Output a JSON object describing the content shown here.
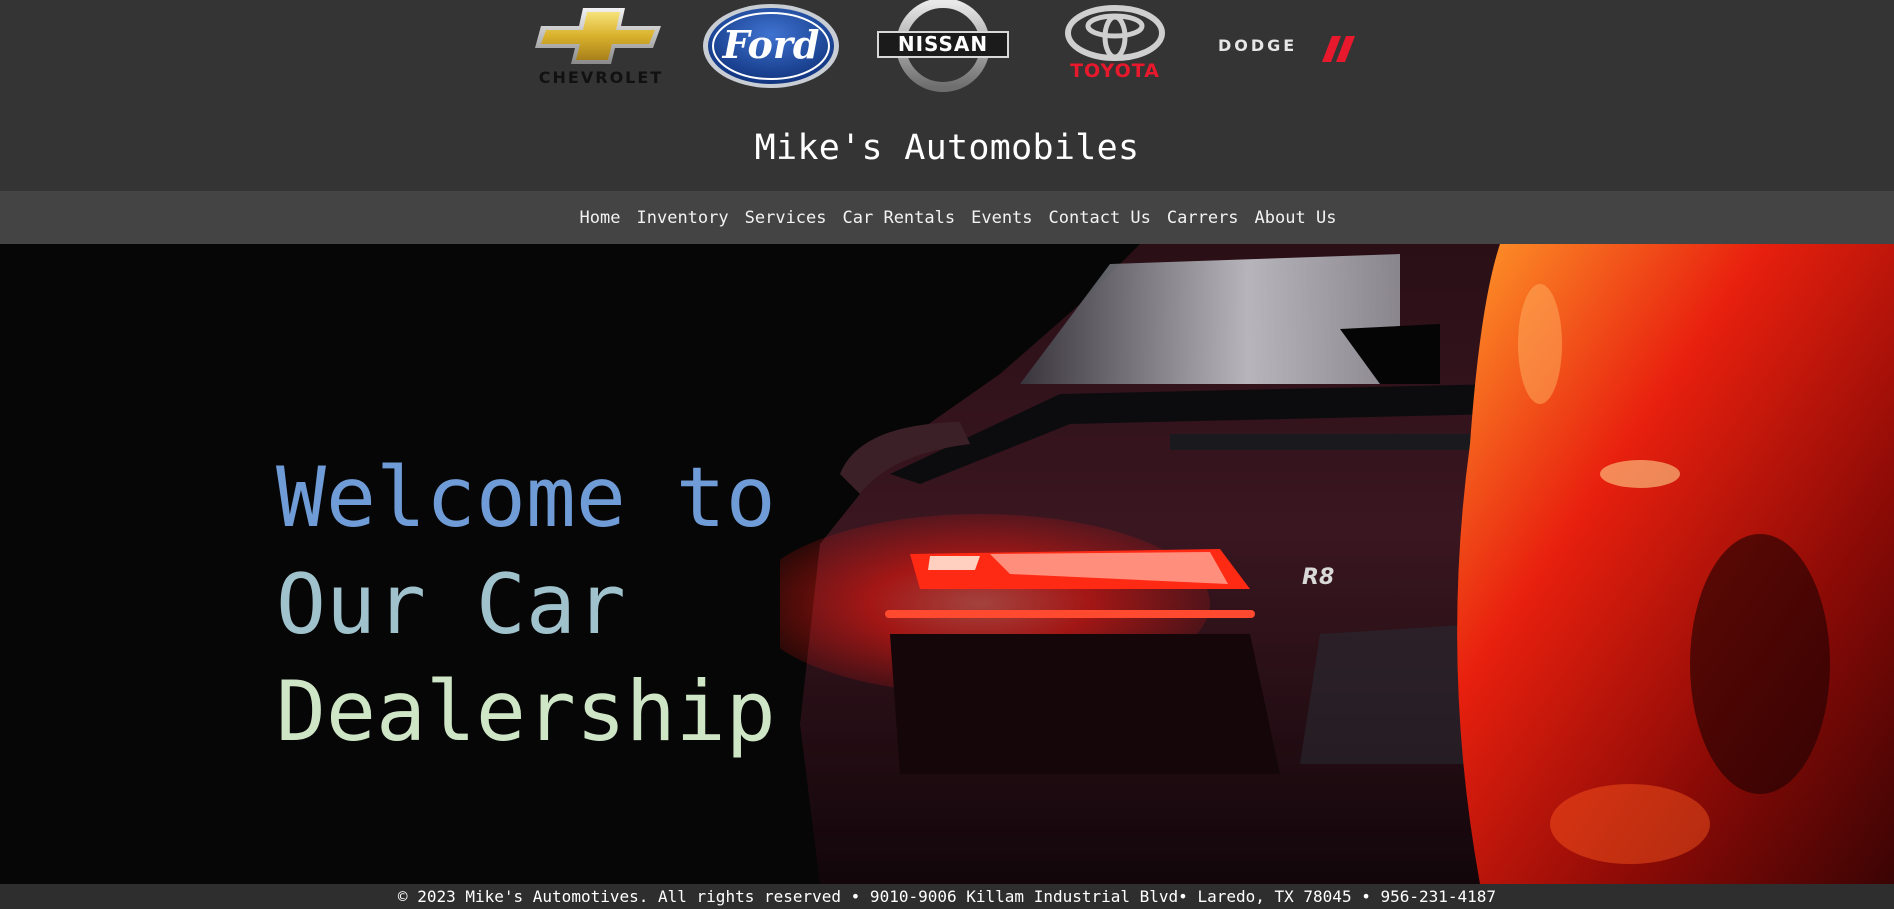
{
  "brands": [
    {
      "name": "CHEVROLET",
      "icon": "chevrolet-logo-icon"
    },
    {
      "name": "Ford",
      "icon": "ford-logo-icon"
    },
    {
      "name": "NISSAN",
      "icon": "nissan-logo-icon"
    },
    {
      "name": "TOYOTA",
      "icon": "toyota-logo-icon"
    },
    {
      "name": "DODGE",
      "icon": "dodge-logo-icon"
    }
  ],
  "site": {
    "title": "Mike's Automobiles"
  },
  "nav": {
    "items": [
      {
        "label": "Home"
      },
      {
        "label": "Inventory"
      },
      {
        "label": "Services"
      },
      {
        "label": "Car Rentals"
      },
      {
        "label": "Events"
      },
      {
        "label": "Contact Us"
      },
      {
        "label": "Carrers"
      },
      {
        "label": "About Us"
      }
    ]
  },
  "hero": {
    "line1": "Welcome to",
    "line2": "Our Car",
    "line3": "Dealership",
    "photo_icon": "car-taillight-photo",
    "badge": "R8"
  },
  "footer": {
    "text": "© 2023 Mike's Automotives. All rights reserved • 9010-9006 Killam Industrial Blvd• Laredo, TX 78045 • 956-231-4187"
  },
  "colors": {
    "header_bg": "#343434",
    "nav_bg": "#444444",
    "hero_bg": "#060606",
    "heading_line1": "#6f9bd6",
    "heading_line2": "#9fc2cc",
    "heading_line3": "#cfe6c6",
    "footer_bg": "#2e2e2e",
    "toyota_red": "#e8192c",
    "dodge_red": "#e8192c",
    "ford_blue": "#1a4aa0"
  }
}
